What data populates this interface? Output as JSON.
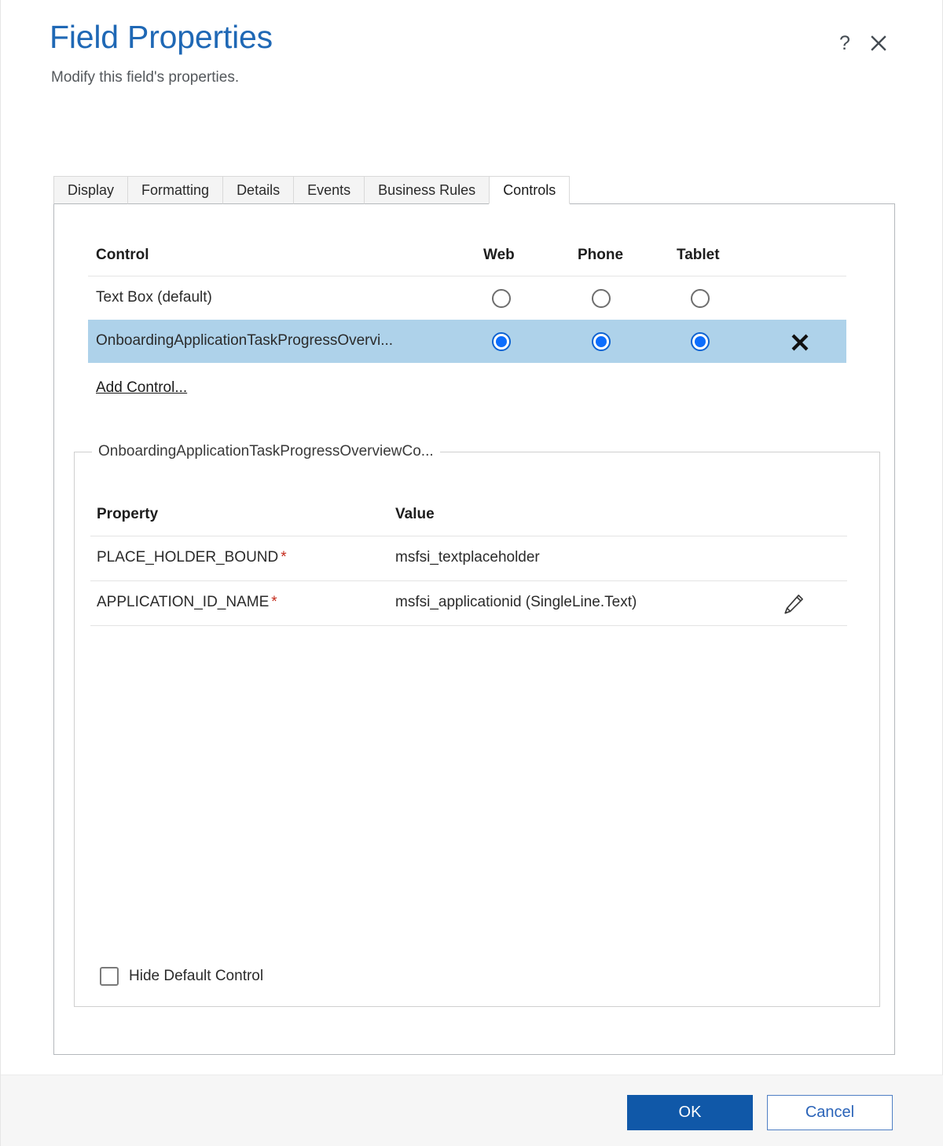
{
  "dialog": {
    "title": "Field Properties",
    "subtitle": "Modify this field's properties.",
    "help_icon": "question-mark-icon",
    "close_icon": "close-icon"
  },
  "tabs": [
    {
      "label": "Display",
      "active": false
    },
    {
      "label": "Formatting",
      "active": false
    },
    {
      "label": "Details",
      "active": false
    },
    {
      "label": "Events",
      "active": false
    },
    {
      "label": "Business Rules",
      "active": false
    },
    {
      "label": "Controls",
      "active": true
    }
  ],
  "controls_table": {
    "headers": {
      "control": "Control",
      "web": "Web",
      "phone": "Phone",
      "tablet": "Tablet"
    },
    "rows": [
      {
        "name": "Text Box (default)",
        "web_checked": false,
        "phone_checked": false,
        "tablet_checked": false,
        "selected": false,
        "has_delete": false
      },
      {
        "name": "OnboardingApplicationTaskProgressOvervi...",
        "web_checked": true,
        "phone_checked": true,
        "tablet_checked": true,
        "selected": true,
        "has_delete": true,
        "delete_icon": "close-x-icon"
      }
    ],
    "add_control_link": "Add Control..."
  },
  "properties_panel": {
    "legend": "OnboardingApplicationTaskProgressOverviewCo...",
    "headers": {
      "property": "Property",
      "value": "Value"
    },
    "rows": [
      {
        "property": "PLACE_HOLDER_BOUND",
        "required": "*",
        "value": "msfsi_textplaceholder",
        "has_edit": false
      },
      {
        "property": "APPLICATION_ID_NAME",
        "required": "*",
        "value": "msfsi_applicationid (SingleLine.Text)",
        "has_edit": true,
        "edit_icon": "pencil-edit-icon"
      }
    ],
    "hide_default_control": {
      "label": "Hide Default Control",
      "checked": false
    }
  },
  "footer": {
    "ok_label": "OK",
    "cancel_label": "Cancel"
  },
  "colors": {
    "title_blue": "#1f68b5",
    "selected_row": "#aed2ea",
    "radio_blue": "#0d6efd",
    "primary_button": "#1058a8",
    "required_star": "#c42b1c"
  }
}
